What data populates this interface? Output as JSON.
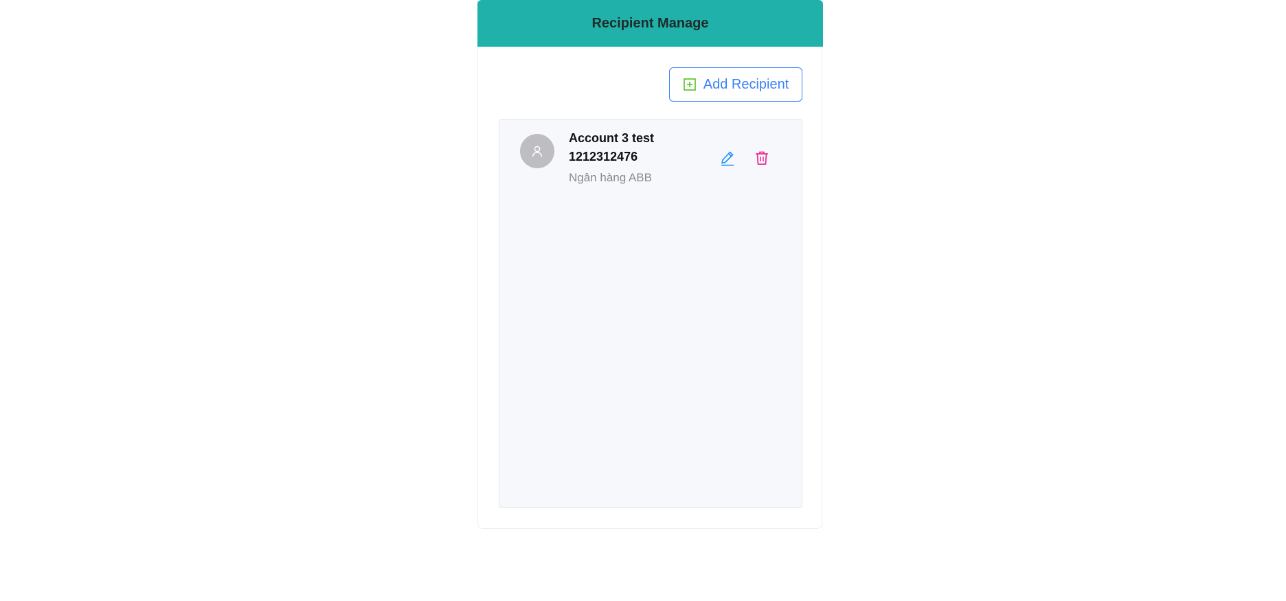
{
  "header": {
    "title": "Recipient Manage"
  },
  "toolbar": {
    "add_label": "Add Recipient",
    "add_icon": "plus-square-icon"
  },
  "recipients": [
    {
      "name": "Account 3 test",
      "account_number": "1212312476",
      "bank": "Ngân hàng ABB",
      "avatar_icon": "user-icon",
      "edit_icon": "pencil-icon",
      "delete_icon": "trash-icon"
    }
  ],
  "colors": {
    "header_bg": "#20b2aa",
    "primary": "#3b82f6",
    "add_icon": "#52c41a",
    "edit_icon": "#1890ff",
    "delete_icon": "#eb2f96",
    "avatar_bg": "#bdbdc2",
    "list_bg": "#f7f8fc"
  }
}
